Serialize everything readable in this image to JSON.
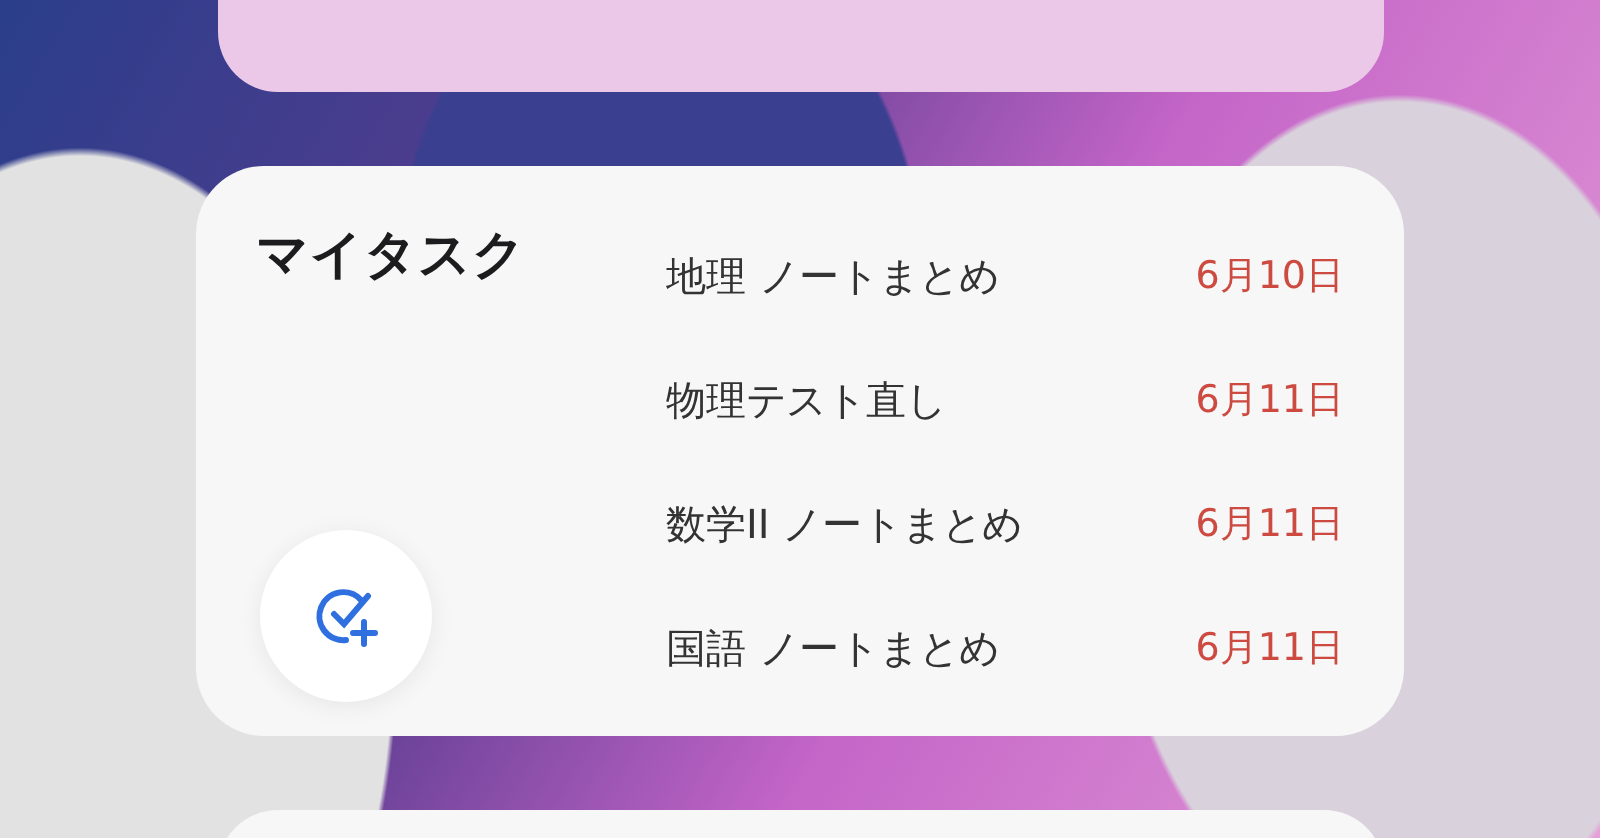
{
  "widget": {
    "title": "マイタスク",
    "tasks": [
      {
        "title": "地理 ノートまとめ",
        "due": "6月10日"
      },
      {
        "title": "物理テスト直し",
        "due": "6月11日"
      },
      {
        "title": "数学II ノートまとめ",
        "due": "6月11日"
      },
      {
        "title": "国語 ノートまとめ",
        "due": "6月11日"
      }
    ]
  }
}
